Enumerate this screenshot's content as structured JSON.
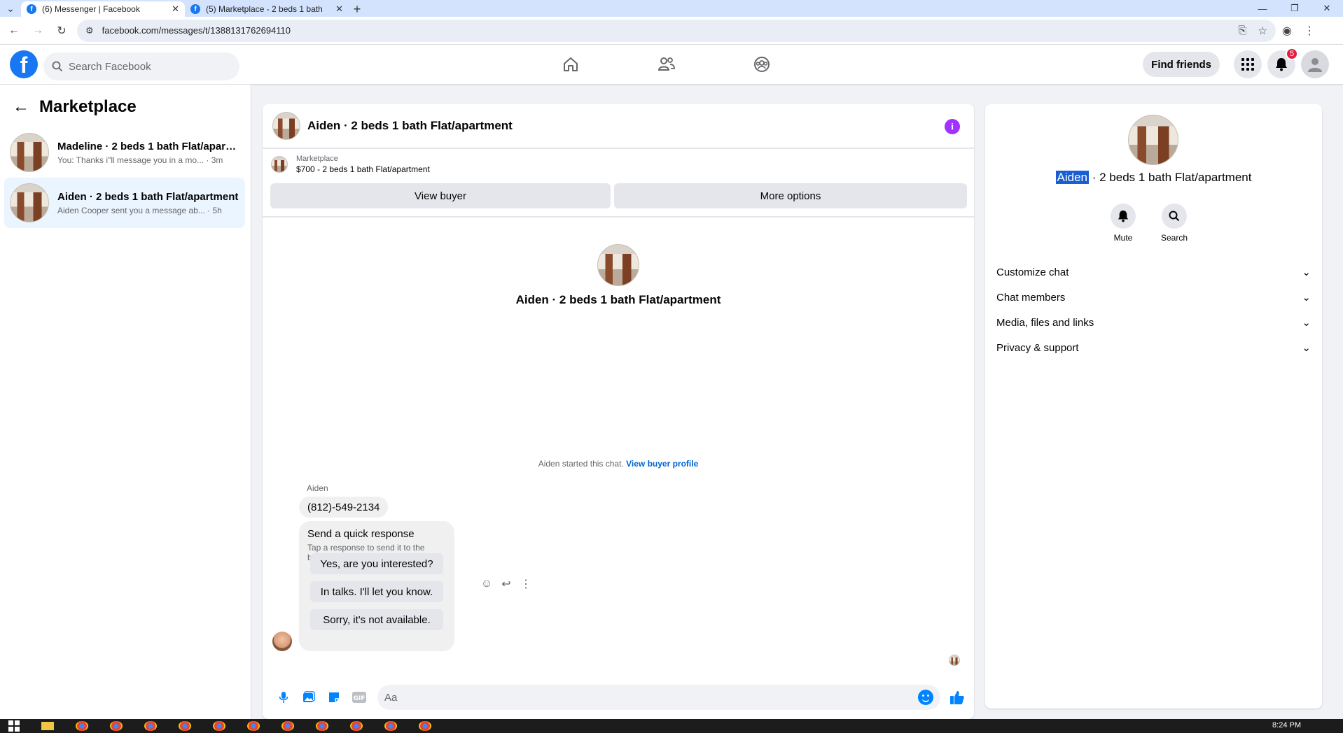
{
  "browser": {
    "tabs": [
      {
        "title": "(6) Messenger | Facebook",
        "active": true
      },
      {
        "title": "(5) Marketplace - 2 beds 1 bath",
        "active": false
      }
    ],
    "url": "facebook.com/messages/t/1388131762694110"
  },
  "fb": {
    "search_placeholder": "Search Facebook",
    "find_friends": "Find friends",
    "notification_count": "5"
  },
  "left": {
    "title": "Marketplace",
    "conversations": [
      {
        "name": "Madeline · 2 beds 1 bath Flat/apartment",
        "snippet": "You: Thanks i\"ll message you in a mo... · 3m",
        "selected": false
      },
      {
        "name": "Aiden · 2 beds 1 bath Flat/apartment",
        "snippet": "Aiden Cooper sent you a message ab... · 5h",
        "selected": true
      }
    ]
  },
  "chat": {
    "header_name": "Aiden · 2 beds 1 bath Flat/apartment",
    "listing_label": "Marketplace",
    "listing_value": "$700 - 2 beds 1 bath Flat/apartment",
    "view_buyer": "View buyer",
    "more_options": "More options",
    "hero_name": "Aiden · 2 beds 1 bath Flat/apartment",
    "started_text": "Aiden started this chat.",
    "started_link": "View buyer profile",
    "sender_name": "Aiden",
    "message": "(812)-549-2134",
    "quick_response": {
      "title": "Send a quick response",
      "subtitle": "Tap a response to send it to the buyer.",
      "options": [
        "Yes, are you interested?",
        "In talks. I'll let you know.",
        "Sorry, it's not available."
      ]
    },
    "composer_placeholder": "Aa"
  },
  "right": {
    "title_highlight": "Aiden",
    "title_rest": " · 2 beds 1 bath Flat/apartment",
    "actions": [
      {
        "label": "Mute",
        "icon": "bell-icon"
      },
      {
        "label": "Search",
        "icon": "search-icon"
      }
    ],
    "sections": [
      "Customize chat",
      "Chat members",
      "Media, files and links",
      "Privacy & support"
    ]
  },
  "taskbar": {
    "time": "8:24 PM"
  }
}
